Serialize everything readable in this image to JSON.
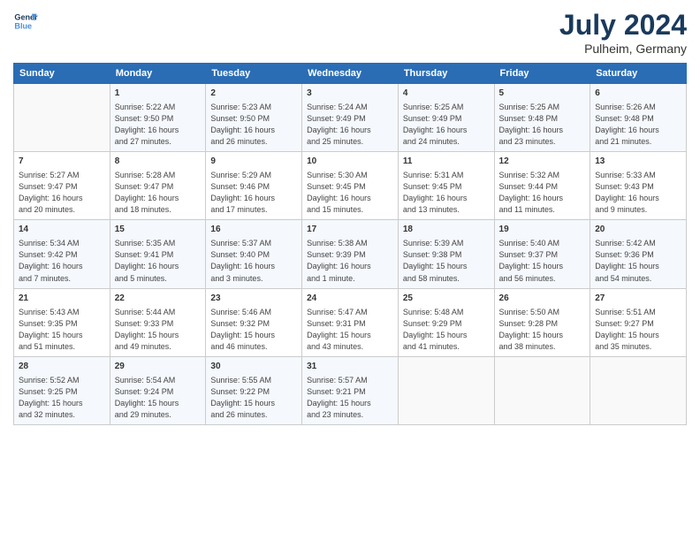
{
  "header": {
    "logo_line1": "General",
    "logo_line2": "Blue",
    "title": "July 2024",
    "subtitle": "Pulheim, Germany"
  },
  "columns": [
    "Sunday",
    "Monday",
    "Tuesday",
    "Wednesday",
    "Thursday",
    "Friday",
    "Saturday"
  ],
  "weeks": [
    [
      {
        "day": "",
        "content": ""
      },
      {
        "day": "1",
        "content": "Sunrise: 5:22 AM\nSunset: 9:50 PM\nDaylight: 16 hours\nand 27 minutes."
      },
      {
        "day": "2",
        "content": "Sunrise: 5:23 AM\nSunset: 9:50 PM\nDaylight: 16 hours\nand 26 minutes."
      },
      {
        "day": "3",
        "content": "Sunrise: 5:24 AM\nSunset: 9:49 PM\nDaylight: 16 hours\nand 25 minutes."
      },
      {
        "day": "4",
        "content": "Sunrise: 5:25 AM\nSunset: 9:49 PM\nDaylight: 16 hours\nand 24 minutes."
      },
      {
        "day": "5",
        "content": "Sunrise: 5:25 AM\nSunset: 9:48 PM\nDaylight: 16 hours\nand 23 minutes."
      },
      {
        "day": "6",
        "content": "Sunrise: 5:26 AM\nSunset: 9:48 PM\nDaylight: 16 hours\nand 21 minutes."
      }
    ],
    [
      {
        "day": "7",
        "content": "Sunrise: 5:27 AM\nSunset: 9:47 PM\nDaylight: 16 hours\nand 20 minutes."
      },
      {
        "day": "8",
        "content": "Sunrise: 5:28 AM\nSunset: 9:47 PM\nDaylight: 16 hours\nand 18 minutes."
      },
      {
        "day": "9",
        "content": "Sunrise: 5:29 AM\nSunset: 9:46 PM\nDaylight: 16 hours\nand 17 minutes."
      },
      {
        "day": "10",
        "content": "Sunrise: 5:30 AM\nSunset: 9:45 PM\nDaylight: 16 hours\nand 15 minutes."
      },
      {
        "day": "11",
        "content": "Sunrise: 5:31 AM\nSunset: 9:45 PM\nDaylight: 16 hours\nand 13 minutes."
      },
      {
        "day": "12",
        "content": "Sunrise: 5:32 AM\nSunset: 9:44 PM\nDaylight: 16 hours\nand 11 minutes."
      },
      {
        "day": "13",
        "content": "Sunrise: 5:33 AM\nSunset: 9:43 PM\nDaylight: 16 hours\nand 9 minutes."
      }
    ],
    [
      {
        "day": "14",
        "content": "Sunrise: 5:34 AM\nSunset: 9:42 PM\nDaylight: 16 hours\nand 7 minutes."
      },
      {
        "day": "15",
        "content": "Sunrise: 5:35 AM\nSunset: 9:41 PM\nDaylight: 16 hours\nand 5 minutes."
      },
      {
        "day": "16",
        "content": "Sunrise: 5:37 AM\nSunset: 9:40 PM\nDaylight: 16 hours\nand 3 minutes."
      },
      {
        "day": "17",
        "content": "Sunrise: 5:38 AM\nSunset: 9:39 PM\nDaylight: 16 hours\nand 1 minute."
      },
      {
        "day": "18",
        "content": "Sunrise: 5:39 AM\nSunset: 9:38 PM\nDaylight: 15 hours\nand 58 minutes."
      },
      {
        "day": "19",
        "content": "Sunrise: 5:40 AM\nSunset: 9:37 PM\nDaylight: 15 hours\nand 56 minutes."
      },
      {
        "day": "20",
        "content": "Sunrise: 5:42 AM\nSunset: 9:36 PM\nDaylight: 15 hours\nand 54 minutes."
      }
    ],
    [
      {
        "day": "21",
        "content": "Sunrise: 5:43 AM\nSunset: 9:35 PM\nDaylight: 15 hours\nand 51 minutes."
      },
      {
        "day": "22",
        "content": "Sunrise: 5:44 AM\nSunset: 9:33 PM\nDaylight: 15 hours\nand 49 minutes."
      },
      {
        "day": "23",
        "content": "Sunrise: 5:46 AM\nSunset: 9:32 PM\nDaylight: 15 hours\nand 46 minutes."
      },
      {
        "day": "24",
        "content": "Sunrise: 5:47 AM\nSunset: 9:31 PM\nDaylight: 15 hours\nand 43 minutes."
      },
      {
        "day": "25",
        "content": "Sunrise: 5:48 AM\nSunset: 9:29 PM\nDaylight: 15 hours\nand 41 minutes."
      },
      {
        "day": "26",
        "content": "Sunrise: 5:50 AM\nSunset: 9:28 PM\nDaylight: 15 hours\nand 38 minutes."
      },
      {
        "day": "27",
        "content": "Sunrise: 5:51 AM\nSunset: 9:27 PM\nDaylight: 15 hours\nand 35 minutes."
      }
    ],
    [
      {
        "day": "28",
        "content": "Sunrise: 5:52 AM\nSunset: 9:25 PM\nDaylight: 15 hours\nand 32 minutes."
      },
      {
        "day": "29",
        "content": "Sunrise: 5:54 AM\nSunset: 9:24 PM\nDaylight: 15 hours\nand 29 minutes."
      },
      {
        "day": "30",
        "content": "Sunrise: 5:55 AM\nSunset: 9:22 PM\nDaylight: 15 hours\nand 26 minutes."
      },
      {
        "day": "31",
        "content": "Sunrise: 5:57 AM\nSunset: 9:21 PM\nDaylight: 15 hours\nand 23 minutes."
      },
      {
        "day": "",
        "content": ""
      },
      {
        "day": "",
        "content": ""
      },
      {
        "day": "",
        "content": ""
      }
    ]
  ]
}
